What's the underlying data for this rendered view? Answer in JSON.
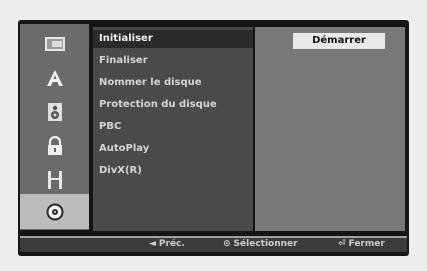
{
  "sidebar": {
    "items": [
      {
        "icon": "disc-icon"
      },
      {
        "icon": "language-a-icon"
      },
      {
        "icon": "audio-speaker-icon"
      },
      {
        "icon": "lock-icon"
      },
      {
        "icon": "film-icon"
      },
      {
        "icon": "disc-settings-icon",
        "active": true
      }
    ]
  },
  "menu": {
    "items": [
      {
        "label": "Initialiser",
        "active": true
      },
      {
        "label": "Finaliser"
      },
      {
        "label": "Nommer le disque"
      },
      {
        "label": "Protection du disque"
      },
      {
        "label": "PBC"
      },
      {
        "label": "AutoPlay"
      },
      {
        "label": "DivX(R)"
      }
    ]
  },
  "panel": {
    "start_label": "Démarrer"
  },
  "footer": {
    "prev_icon": "◄",
    "prev_label": "Préc.",
    "select_icon": "⊙",
    "select_label": "Sélectionner",
    "close_icon": "⏎",
    "close_label": "Fermer"
  }
}
